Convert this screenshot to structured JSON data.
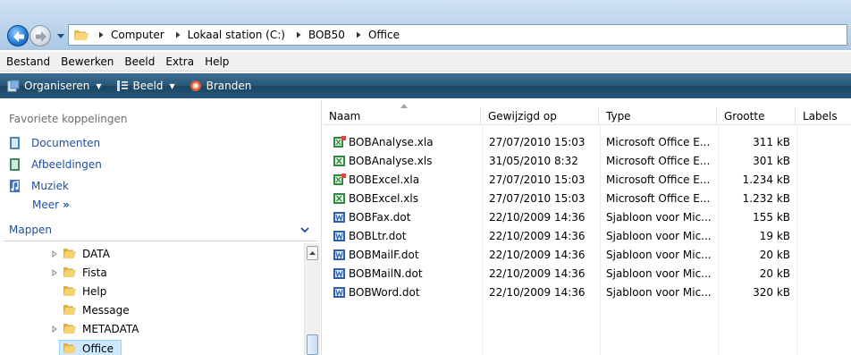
{
  "address_bar": {
    "breadcrumbs": [
      "Computer",
      "Lokaal station (C:)",
      "BOB50",
      "Office"
    ]
  },
  "menu_bar": {
    "items": [
      "Bestand",
      "Bewerken",
      "Beeld",
      "Extra",
      "Help"
    ]
  },
  "toolbar": {
    "organize_label": "Organiseren",
    "view_label": "Beeld",
    "burn_label": "Branden"
  },
  "navigation": {
    "favorites_header": "Favoriete koppelingen",
    "favorites": [
      "Documenten",
      "Afbeeldingen",
      "Muziek"
    ],
    "more_label": "Meer",
    "folders_header": "Mappen",
    "tree": [
      {
        "label": "DATA",
        "expandable": true
      },
      {
        "label": "Fista",
        "expandable": true
      },
      {
        "label": "Help",
        "expandable": false
      },
      {
        "label": "Message",
        "expandable": false
      },
      {
        "label": "METADATA",
        "expandable": true
      },
      {
        "label": "Office",
        "expandable": false,
        "selected": true
      }
    ]
  },
  "file_list": {
    "columns": [
      "Naam",
      "Gewijzigd op",
      "Type",
      "Grootte",
      "Labels"
    ],
    "files": [
      {
        "name": "BOBAnalyse.xla",
        "modified": "27/07/2010 15:03",
        "type": "Microsoft Office E...",
        "size": "311 kB",
        "icon": "excel-addin-icon"
      },
      {
        "name": "BOBAnalyse.xls",
        "modified": "31/05/2010 8:32",
        "type": "Microsoft Office E...",
        "size": "301 kB",
        "icon": "excel-file-icon"
      },
      {
        "name": "BOBExcel.xla",
        "modified": "27/07/2010 15:03",
        "type": "Microsoft Office E...",
        "size": "1.234 kB",
        "icon": "excel-addin-icon"
      },
      {
        "name": "BOBExcel.xls",
        "modified": "27/07/2010 15:03",
        "type": "Microsoft Office E...",
        "size": "1.232 kB",
        "icon": "excel-file-icon"
      },
      {
        "name": "BOBFax.dot",
        "modified": "22/10/2009 14:36",
        "type": "Sjabloon voor Mic...",
        "size": "155 kB",
        "icon": "word-template-icon"
      },
      {
        "name": "BOBLtr.dot",
        "modified": "22/10/2009 14:36",
        "type": "Sjabloon voor Mic...",
        "size": "19 kB",
        "icon": "word-template-icon"
      },
      {
        "name": "BOBMailF.dot",
        "modified": "22/10/2009 14:36",
        "type": "Sjabloon voor Mic...",
        "size": "20 kB",
        "icon": "word-template-icon"
      },
      {
        "name": "BOBMailN.dot",
        "modified": "22/10/2009 14:36",
        "type": "Sjabloon voor Mic...",
        "size": "20 kB",
        "icon": "word-template-icon"
      },
      {
        "name": "BOBWord.dot",
        "modified": "22/10/2009 14:36",
        "type": "Sjabloon voor Mic...",
        "size": "320 kB",
        "icon": "word-template-icon"
      }
    ]
  },
  "colors": {
    "link_blue": "#1e4d9c",
    "toolbar_dark": "#1b4563",
    "selection": "#cde8ff"
  }
}
